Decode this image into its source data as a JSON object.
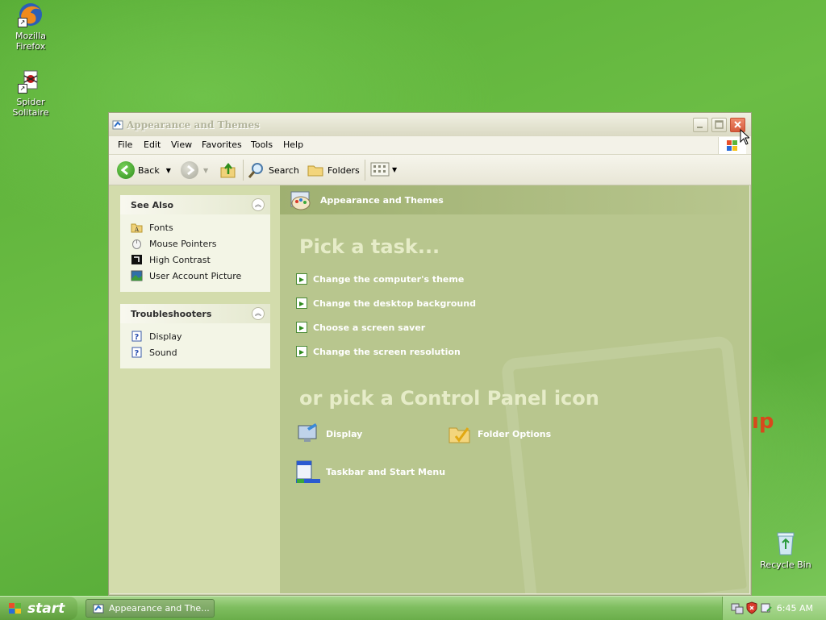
{
  "desktop": {
    "icons": [
      {
        "label": "Mozilla Firefox"
      },
      {
        "label": "Spider Solitaire"
      },
      {
        "label": "Recycle Bin"
      }
    ]
  },
  "window": {
    "title": "Appearance and Themes",
    "menu": [
      "File",
      "Edit",
      "View",
      "Favorites",
      "Tools",
      "Help"
    ],
    "toolbar": {
      "back_label": "Back",
      "search_label": "Search",
      "folders_label": "Folders"
    },
    "see_also": {
      "title": "See Also",
      "items": [
        {
          "label": "Fonts",
          "icon": "fonts-folder-icon"
        },
        {
          "label": "Mouse Pointers",
          "icon": "mouse-icon"
        },
        {
          "label": "High Contrast",
          "icon": "contrast-icon"
        },
        {
          "label": "User Account Picture",
          "icon": "picture-icon"
        }
      ]
    },
    "troubleshooters": {
      "title": "Troubleshooters",
      "items": [
        {
          "label": "Display",
          "icon": "help-icon"
        },
        {
          "label": "Sound",
          "icon": "help-icon"
        }
      ]
    },
    "category_title": "Appearance and Themes",
    "pick_task_heading": "Pick a task...",
    "tasks": [
      "Change the computer's theme",
      "Change the desktop background",
      "Choose a screen saver",
      "Change the screen resolution"
    ],
    "pick_icon_heading": "or pick a Control Panel icon",
    "control_panel_icons": [
      {
        "label": "Display"
      },
      {
        "label": "Folder Options"
      },
      {
        "label": "Taskbar and Start Menu"
      }
    ]
  },
  "taskbar": {
    "start_label": "start",
    "task_button_label": "Appearance and The...",
    "clock": "6:45 AM"
  }
}
